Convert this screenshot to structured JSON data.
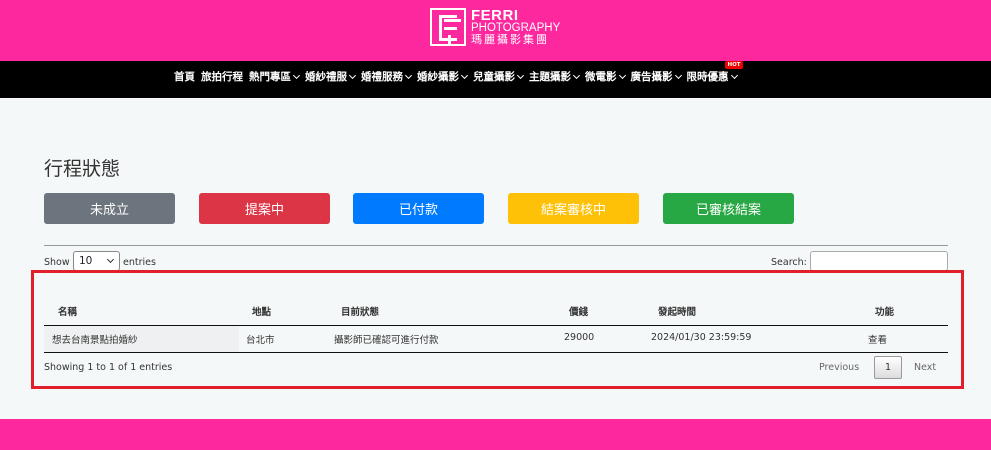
{
  "brand": {
    "line1": "FERRI",
    "line2": "PHOTOGRAPHY",
    "line3": "瑪麗攝影集團"
  },
  "nav": {
    "items": [
      {
        "label": "首頁",
        "dropdown": false
      },
      {
        "label": "旅拍行程",
        "dropdown": false
      },
      {
        "label": "熱門專區",
        "dropdown": true
      },
      {
        "label": "婚紗禮服",
        "dropdown": true
      },
      {
        "label": "婚禮服務",
        "dropdown": true
      },
      {
        "label": "婚紗攝影",
        "dropdown": true
      },
      {
        "label": "兒童攝影",
        "dropdown": true
      },
      {
        "label": "主題攝影",
        "dropdown": true
      },
      {
        "label": "微電影",
        "dropdown": true
      },
      {
        "label": "廣告攝影",
        "dropdown": true
      },
      {
        "label": "限時優惠",
        "dropdown": true,
        "badge": "HOT"
      }
    ]
  },
  "page": {
    "title": "行程狀態"
  },
  "status_buttons": [
    {
      "label": "未成立",
      "color": "#6c757d"
    },
    {
      "label": "提案中",
      "color": "#dc3545"
    },
    {
      "label": "已付款",
      "color": "#007bff"
    },
    {
      "label": "結案審核中",
      "color": "#ffc107"
    },
    {
      "label": "已審核結案",
      "color": "#28a745"
    }
  ],
  "table_controls": {
    "show_label": "Show",
    "length_value": "10",
    "entries_label": "entries",
    "search_label": "Search:",
    "search_value": ""
  },
  "table": {
    "columns": [
      "名稱",
      "地點",
      "目前狀態",
      "價錢",
      "發起時間",
      "功能"
    ],
    "rows": [
      {
        "name": "想去台南景點拍婚紗",
        "location": "台北市",
        "status": "攝影師已確認可進行付款",
        "price": "29000",
        "start_time": "2024/01/30 23:59:59",
        "action": "查看"
      }
    ]
  },
  "pagination": {
    "info": "Showing 1 to 1 of 1 entries",
    "previous": "Previous",
    "current": "1",
    "next": "Next"
  },
  "colors": {
    "brand_pink": "#fd279e",
    "nav_black": "#000000",
    "highlight_red": "#e11f2a"
  }
}
